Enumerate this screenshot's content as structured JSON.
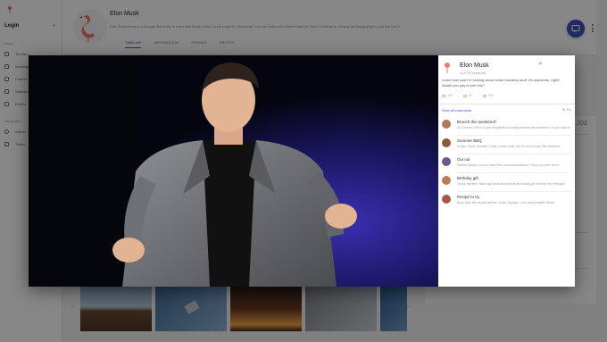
{
  "sidebar": {
    "login_label": "Login",
    "caret": "▾",
    "section_menu": "Menu",
    "items": [
      {
        "label": "Timeline",
        "icon": "list-icon"
      },
      {
        "label": "Messages",
        "icon": "message-icon"
      },
      {
        "label": "Friends",
        "icon": "person-icon"
      },
      {
        "label": "Statistics",
        "icon": "chart-icon"
      },
      {
        "label": "Events",
        "icon": "calendar-icon"
      }
    ],
    "section_navigation": "Navigation",
    "nav_items": [
      {
        "label": "Github",
        "icon": "github-icon"
      },
      {
        "label": "Twitter",
        "icon": "twitter-icon"
      }
    ]
  },
  "profile": {
    "name": "Elon Musk",
    "bio": "Elon Zuckerberg is a Google-like entity to represent Musk in the Lorem page for Javascript. You can really see Kreml material. Nice UI design is coming via Design(ing) so please use it.",
    "tabs": [
      "TIMELINE",
      "INFORMATION",
      "FRIENDS",
      "PHOTOS"
    ],
    "active_tab": "TIMELINE"
  },
  "right_panel": {
    "number": "203"
  },
  "thumbnails": {
    "prev": "‹",
    "next": "›"
  },
  "lightbox": {
    "close": "✕",
    "author": "Elon Musk",
    "time": "4:15 PM yesterday",
    "text": "Learn how cool I'm looking about some business stuff. It's awesome, right? Would you pay to see this?",
    "actions": {
      "likes": "109",
      "comments": "64",
      "shares": "402"
    },
    "view_all_label": "View all comments",
    "comment_count": "5k 12k",
    "comments": [
      {
        "title": "Brunch this weekend?",
        "snippet": "Ali Connors: I'll be in your neighborhood doing errands this weekend. Do you want to grab brunch?",
        "avatar_color": "#b07a55"
      },
      {
        "title": "Summer BBQ",
        "snippet": "to Alex, Scott, Jennifer: I wish I could come, but I'm out of town this weekend.",
        "avatar_color": "#8a5a3c"
      },
      {
        "title": "Oui oui",
        "snippet": "Sandra Adams: Do you have Paris recommendations? Have you ever been?",
        "avatar_color": "#6e5a8a"
      },
      {
        "title": "Birthday gift",
        "snippet": "Trevor Hansen: Have any ideas about what we should get Heidi for her birthday?",
        "avatar_color": "#c27a54"
      },
      {
        "title": "Recipe to try",
        "snippet": "Brian Holt: We should eat this: Grate, Squash, Corn, and tomatillo Tacos.",
        "avatar_color": "#a8564a"
      }
    ]
  },
  "colors": {
    "accent": "#3f51b5",
    "flamingo": "#f07a6a"
  }
}
